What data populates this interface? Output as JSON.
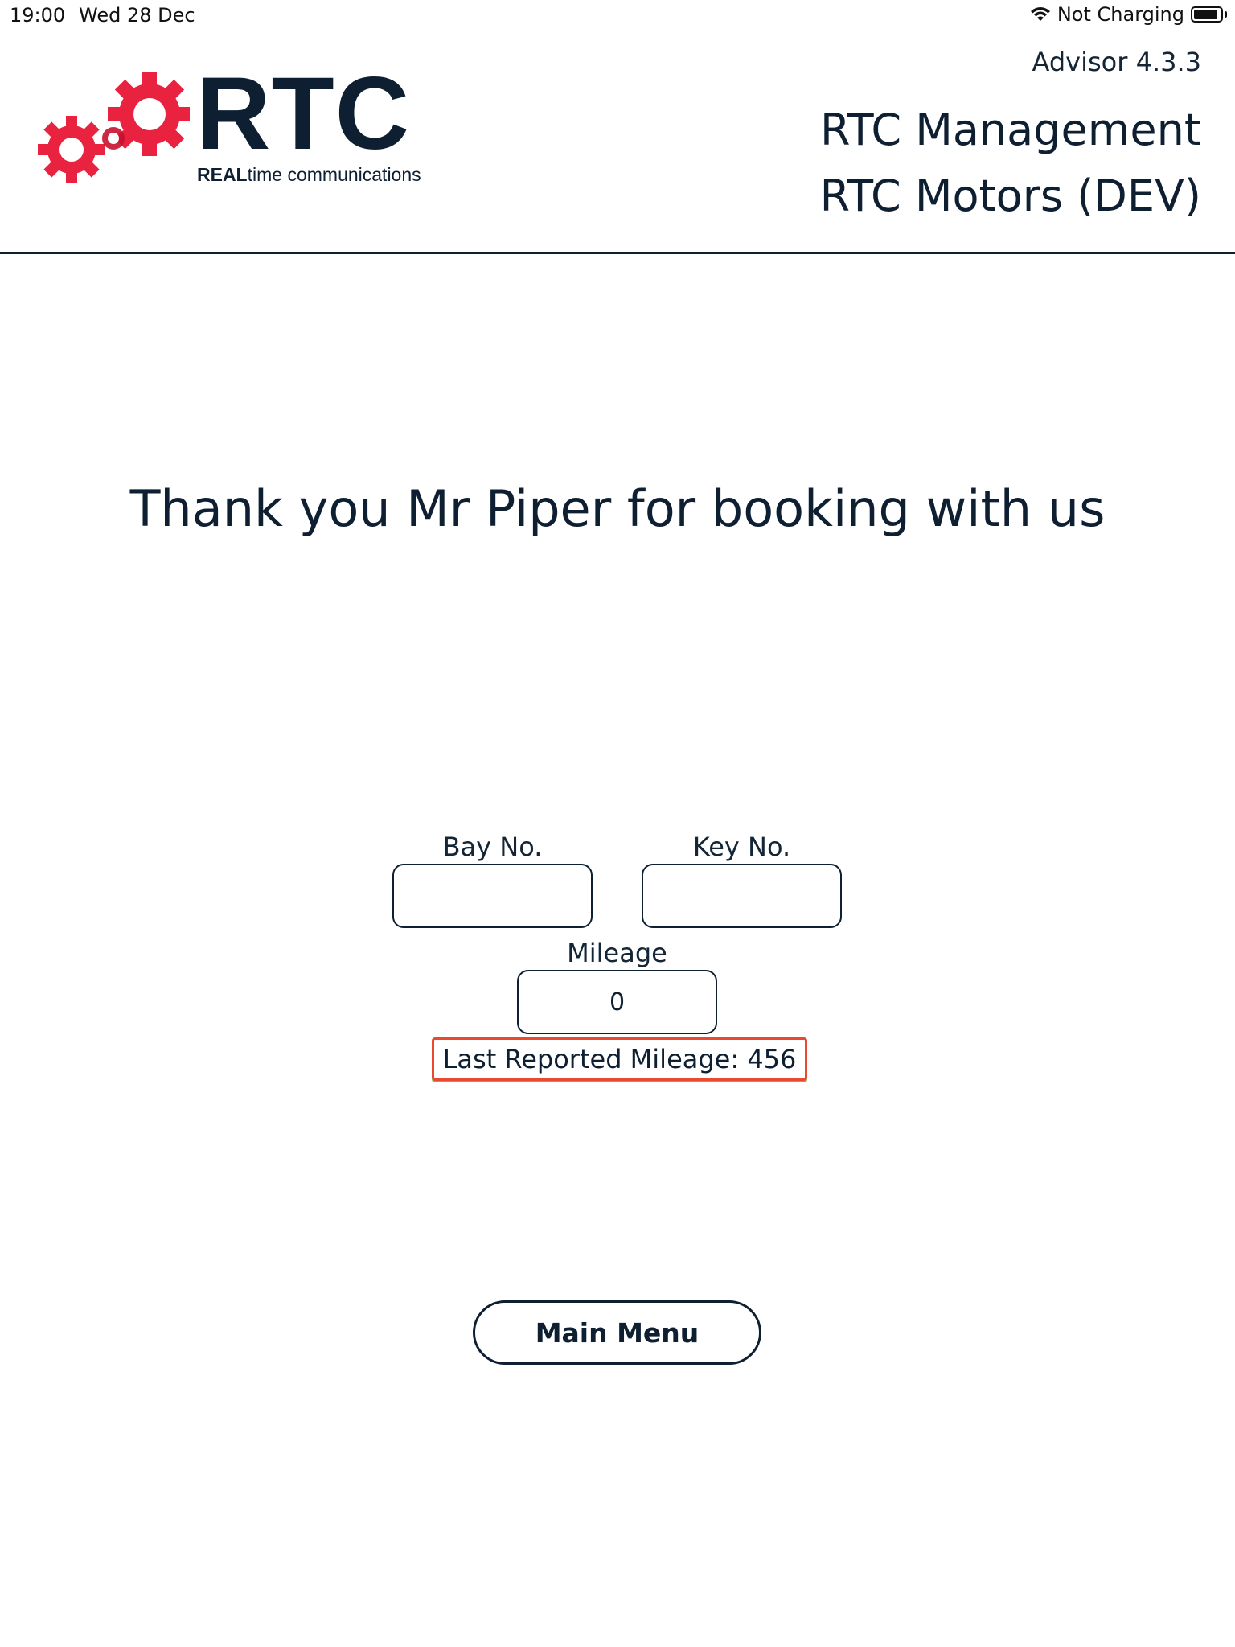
{
  "status_bar": {
    "time": "19:00",
    "date": "Wed 28 Dec",
    "charging_status": "Not Charging",
    "battery_level_percent": 90,
    "wifi_icon": "wifi-icon",
    "battery_icon": "battery-icon"
  },
  "header": {
    "logo": {
      "name": "RTC",
      "tagline_bold": "REAL",
      "tagline_rest": "time communications",
      "gear_color": "#e8223f",
      "text_color": "#0e1f32"
    },
    "advisor_version": "Advisor 4.3.3",
    "company_name": "RTC Management",
    "site_name": "RTC Motors (DEV)"
  },
  "main": {
    "thank_you_message": "Thank you Mr Piper for booking with us",
    "bay_no": {
      "label": "Bay No.",
      "value": ""
    },
    "key_no": {
      "label": "Key No.",
      "value": ""
    },
    "mileage": {
      "label": "Mileage",
      "value": "0"
    },
    "last_reported_mileage": "Last Reported Mileage: 456",
    "main_menu_label": "Main Menu"
  }
}
